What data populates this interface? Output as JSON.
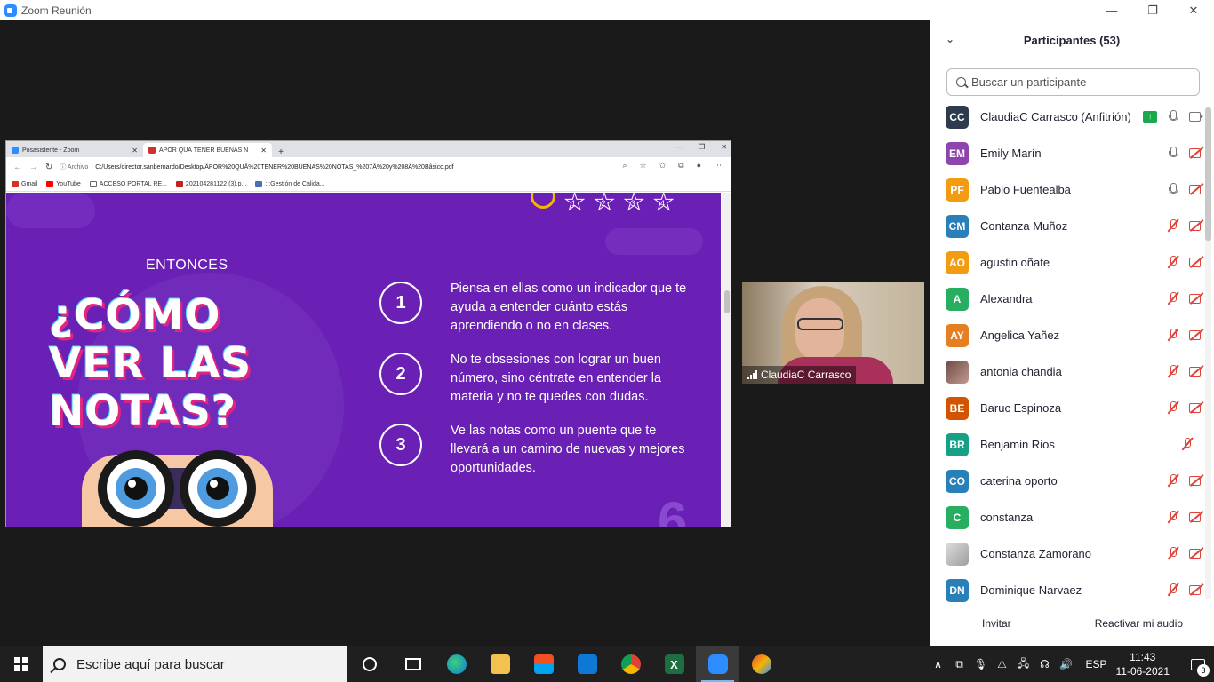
{
  "zoom_window": {
    "title": "Zoom Reunión",
    "controls": {
      "minimize": "—",
      "restore": "❐",
      "close": "✕"
    }
  },
  "browser": {
    "tabs": [
      {
        "label": "Posasistente - Zoom",
        "close": "✕",
        "active": false
      },
      {
        "label": "ÂPOR QUÃ TENER BUENAS NOT",
        "close": "✕",
        "active": true
      }
    ],
    "new_tab": "+",
    "window_controls": {
      "minimize": "—",
      "restore": "❐",
      "close": "✕"
    },
    "nav": {
      "back": "←",
      "forward": "→",
      "reload": "↻"
    },
    "address": {
      "badge": "ⓘ Archivo",
      "url": "C:/Users/director.sanbernardo/Desktop/ÂPOR%20QUÃ%20TENER%20BUENAS%20NOTAS_%207Â%20y%208Â%20Bâsico.pdf"
    },
    "bookmarks": [
      {
        "label": "Gmail",
        "color": "#d93025"
      },
      {
        "label": "YouTube",
        "color": "#ff0000"
      },
      {
        "label": "ACCESO PORTAL RE...",
        "color": "#ffffff"
      },
      {
        "label": "202104281122 (3).p...",
        "color": "#c5221f"
      },
      {
        "label": ":::Gestión de Calida...",
        "color": "#4a6fb5"
      }
    ]
  },
  "slide": {
    "kicker": "ENTONCES",
    "title_lines": [
      "¿CÓMO",
      "VER LAS",
      "NOTAS?"
    ],
    "stars": [
      "1",
      "2",
      "3",
      "4"
    ],
    "page_number": "6",
    "items": [
      {
        "number": "1",
        "text": "Piensa en ellas como un indicador que te ayuda a entender cuánto estás aprendiendo o no en clases."
      },
      {
        "number": "2",
        "text": "No te obsesiones con lograr un buen número, sino céntrate en entender la materia y no te quedes con dudas."
      },
      {
        "number": "3",
        "text": "Ve las notas como un puente que te llevará a un camino de nuevas y mejores oportunidades."
      }
    ]
  },
  "video": {
    "name": "ClaudiaC Carrasco"
  },
  "participants_panel": {
    "title": "Participantes (53)",
    "collapse_icon": "⌄",
    "search_placeholder": "Buscar un participante",
    "participants": [
      {
        "initials": "CC",
        "name": "ClaudiaC Carrasco (Anfitrión)",
        "color": "#2e3a4e",
        "share": true,
        "mic": "on",
        "cam": "on"
      },
      {
        "initials": "EM",
        "name": "Emily Marín",
        "color": "#8e44ad",
        "mic": "on",
        "cam": "off"
      },
      {
        "initials": "PF",
        "name": "Pablo Fuentealba",
        "color": "#f39c12",
        "mic": "on",
        "cam": "off"
      },
      {
        "initials": "CM",
        "name": " Contanza Muñoz",
        "color": "#2980b9",
        "mic": "off",
        "cam": "off"
      },
      {
        "initials": "AO",
        "name": "agustin oñate",
        "color": "#f39c12",
        "mic": "off",
        "cam": "off"
      },
      {
        "initials": "A",
        "name": "Alexandra",
        "color": "#27ae60",
        "mic": "off",
        "cam": "off"
      },
      {
        "initials": "AY",
        "name": "Angelica Yañez",
        "color": "#e67e22",
        "mic": "off",
        "cam": "off"
      },
      {
        "initials": "",
        "name": "antonia chandia",
        "photo": "ant",
        "mic": "off",
        "cam": "off"
      },
      {
        "initials": "BE",
        "name": "Baruc Espinoza",
        "color": "#d35400",
        "mic": "off",
        "cam": "off"
      },
      {
        "initials": "BR",
        "name": "Benjamin Rios",
        "color": "#16a085",
        "mic": "off",
        "cam": "none"
      },
      {
        "initials": "CO",
        "name": "caterina oporto",
        "color": "#2980b9",
        "mic": "off",
        "cam": "off"
      },
      {
        "initials": "C",
        "name": "constanza",
        "color": "#27ae60",
        "mic": "off",
        "cam": "off"
      },
      {
        "initials": "",
        "name": "Constanza Zamorano",
        "photo": "cz",
        "mic": "off",
        "cam": "off"
      },
      {
        "initials": "DN",
        "name": "Dominique Narvaez",
        "color": "#2980b9",
        "mic": "off",
        "cam": "off"
      }
    ],
    "invite_label": "Invitar",
    "unmute_label": "Reactivar mi audio"
  },
  "taskbar": {
    "search_placeholder": "Escribe aquí para buscar",
    "excel_letter": "X",
    "tray": {
      "chevron": "∧",
      "icons": [
        "⧉",
        "🎙",
        "⚠",
        "🖧",
        "☊",
        "🔊"
      ],
      "language": "ESP",
      "time": "11:43",
      "date": "11-06-2021",
      "notifications": "3"
    }
  }
}
